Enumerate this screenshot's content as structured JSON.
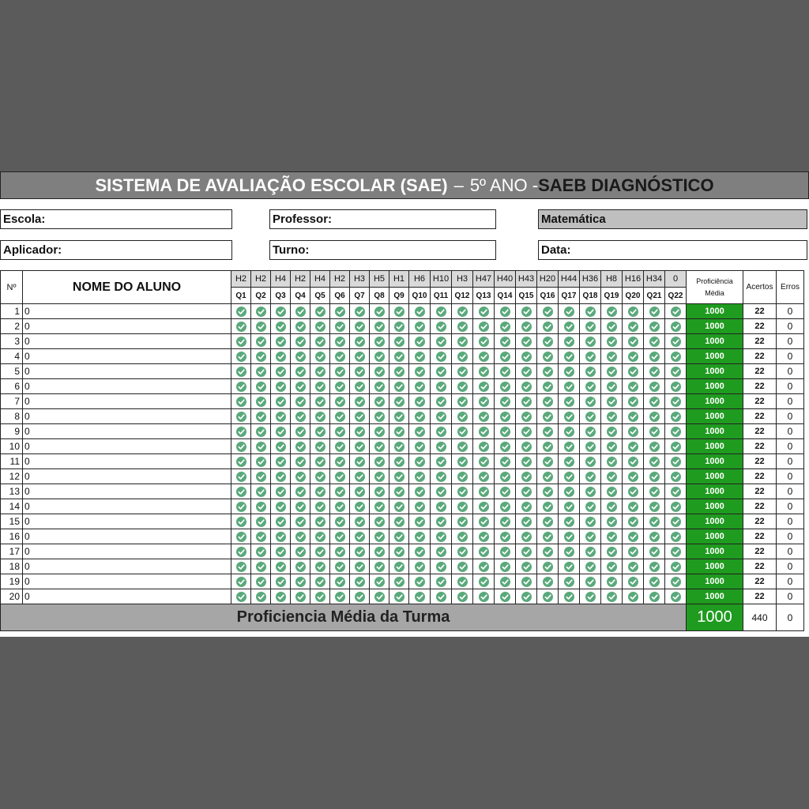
{
  "title": {
    "main": "SISTEMA DE AVALIAÇÃO ESCOLAR (SAE)",
    "dash": "–",
    "year": "5º ANO -",
    "diag": "SAEB DIAGNÓSTICO"
  },
  "info": {
    "escola_label": "Escola:",
    "escola_value": "",
    "professor_label": "Professor:",
    "professor_value": "",
    "subject": "Matemática",
    "aplicador_label": "Aplicador:",
    "aplicador_value": "",
    "turno_label": "Turno:",
    "turno_value": "",
    "data_label": "Data:",
    "data_value": ""
  },
  "colors": {
    "proficiency_green": "#1f9b1f",
    "check_green": "#5aa97b",
    "title_gray": "#7f7f7f"
  },
  "table": {
    "header_num": "Nº",
    "header_name": "NOME DO ALUNO",
    "header_prof": "Proficiência Média",
    "header_acertos": "Acertos",
    "header_erros": "Erros",
    "skills": [
      "H2",
      "H2",
      "H4",
      "H2",
      "H4",
      "H2",
      "H3",
      "H5",
      "H1",
      "H6",
      "H10",
      "H3",
      "H47",
      "H40",
      "H43",
      "H20",
      "H44",
      "H36",
      "H8",
      "H16",
      "H34",
      "0"
    ],
    "questions": [
      "Q1",
      "Q2",
      "Q3",
      "Q4",
      "Q5",
      "Q6",
      "Q7",
      "Q8",
      "Q9",
      "Q10",
      "Q11",
      "Q12",
      "Q13",
      "Q14",
      "Q15",
      "Q16",
      "Q17",
      "Q18",
      "Q19",
      "Q20",
      "Q21",
      "Q22"
    ],
    "answer_icon": "check-circle-icon",
    "rows": [
      {
        "num": "1",
        "name": "0",
        "prof": "1000",
        "acertos": "22",
        "erros": "0"
      },
      {
        "num": "2",
        "name": "0",
        "prof": "1000",
        "acertos": "22",
        "erros": "0"
      },
      {
        "num": "3",
        "name": "0",
        "prof": "1000",
        "acertos": "22",
        "erros": "0"
      },
      {
        "num": "4",
        "name": "0",
        "prof": "1000",
        "acertos": "22",
        "erros": "0"
      },
      {
        "num": "5",
        "name": "0",
        "prof": "1000",
        "acertos": "22",
        "erros": "0"
      },
      {
        "num": "6",
        "name": "0",
        "prof": "1000",
        "acertos": "22",
        "erros": "0"
      },
      {
        "num": "7",
        "name": "0",
        "prof": "1000",
        "acertos": "22",
        "erros": "0"
      },
      {
        "num": "8",
        "name": "0",
        "prof": "1000",
        "acertos": "22",
        "erros": "0"
      },
      {
        "num": "9",
        "name": "0",
        "prof": "1000",
        "acertos": "22",
        "erros": "0"
      },
      {
        "num": "10",
        "name": "0",
        "prof": "1000",
        "acertos": "22",
        "erros": "0"
      },
      {
        "num": "11",
        "name": "0",
        "prof": "1000",
        "acertos": "22",
        "erros": "0"
      },
      {
        "num": "12",
        "name": "0",
        "prof": "1000",
        "acertos": "22",
        "erros": "0"
      },
      {
        "num": "13",
        "name": "0",
        "prof": "1000",
        "acertos": "22",
        "erros": "0"
      },
      {
        "num": "14",
        "name": "0",
        "prof": "1000",
        "acertos": "22",
        "erros": "0"
      },
      {
        "num": "15",
        "name": "0",
        "prof": "1000",
        "acertos": "22",
        "erros": "0"
      },
      {
        "num": "16",
        "name": "0",
        "prof": "1000",
        "acertos": "22",
        "erros": "0"
      },
      {
        "num": "17",
        "name": "0",
        "prof": "1000",
        "acertos": "22",
        "erros": "0"
      },
      {
        "num": "18",
        "name": "0",
        "prof": "1000",
        "acertos": "22",
        "erros": "0"
      },
      {
        "num": "19",
        "name": "0",
        "prof": "1000",
        "acertos": "22",
        "erros": "0"
      },
      {
        "num": "20",
        "name": "0",
        "prof": "1000",
        "acertos": "22",
        "erros": "0"
      }
    ],
    "footer": {
      "label": "Proficiencia Média da Turma",
      "prof": "1000",
      "acertos": "440",
      "erros": "0"
    }
  }
}
